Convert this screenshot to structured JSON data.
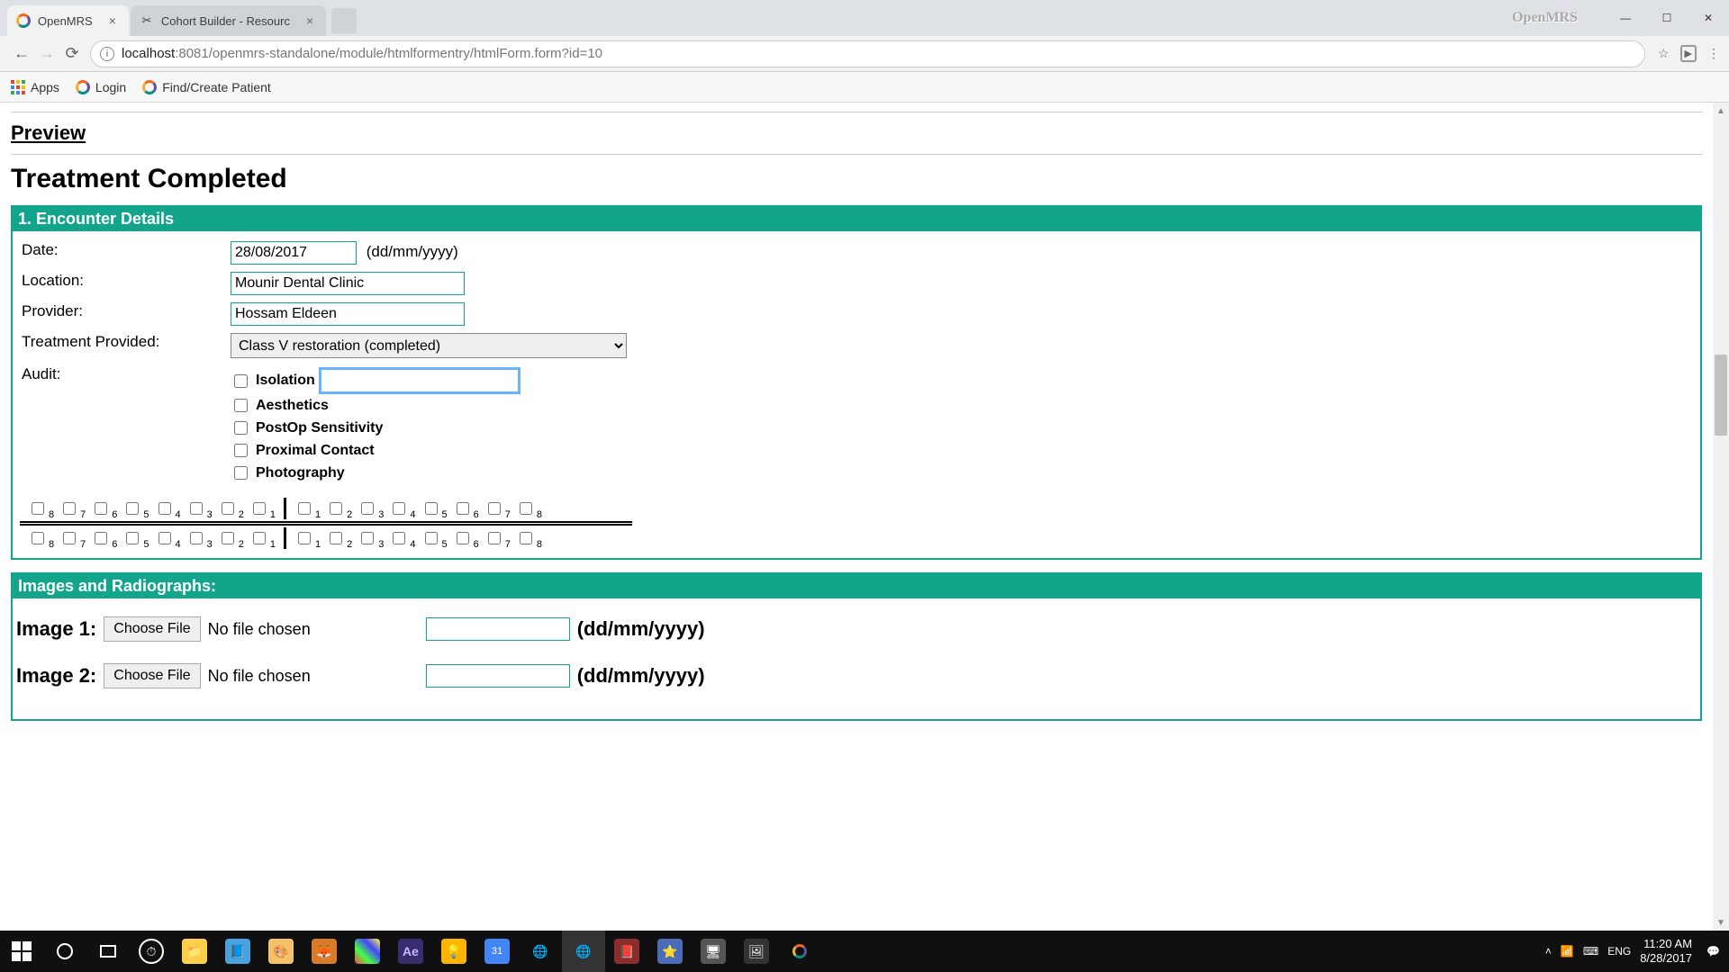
{
  "browser": {
    "tabs": [
      {
        "title": "OpenMRS",
        "active": true
      },
      {
        "title": "Cohort Builder - Resourc",
        "active": false
      }
    ],
    "url_host": "localhost",
    "url_path": ":8081/openmrs-standalone/module/htmlformentry/htmlForm.form?id=10",
    "watermark": "OpenMRS"
  },
  "bookmarks": {
    "apps": "Apps",
    "login": "Login",
    "find_patient": "Find/Create Patient"
  },
  "page": {
    "preview": "Preview",
    "title": "Treatment Completed",
    "section1_header": "1. Encounter Details",
    "labels": {
      "date": "Date:",
      "location": "Location:",
      "provider": "Provider:",
      "treatment": "Treatment Provided:",
      "audit": "Audit:"
    },
    "values": {
      "date": "28/08/2017",
      "date_hint": "(dd/mm/yyyy)",
      "location": "Mounir Dental Clinic",
      "provider": "Hossam Eldeen",
      "treatment": "Class V restoration (completed)",
      "isolation_text": ""
    },
    "audit": {
      "isolation": "Isolation",
      "aesthetics": "Aesthetics",
      "postop": "PostOp Sensitivity",
      "proximal": "Proximal Contact",
      "photography": "Photography"
    },
    "teeth_left": [
      "8",
      "7",
      "6",
      "5",
      "4",
      "3",
      "2",
      "1"
    ],
    "teeth_right": [
      "1",
      "2",
      "3",
      "4",
      "5",
      "6",
      "7",
      "8"
    ],
    "section2_header": "Images and Radiographs:",
    "images": {
      "img1_label": "Image 1:",
      "img2_label": "Image 2:",
      "choose": "Choose File",
      "nofile": "No file chosen",
      "date_hint": "(dd/mm/yyyy)"
    }
  },
  "taskbar": {
    "lang": "ENG",
    "time": "11:20 AM",
    "date": "8/28/2017"
  }
}
